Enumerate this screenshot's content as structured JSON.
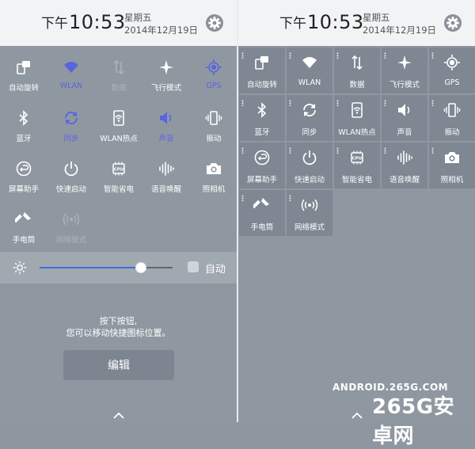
{
  "left_panel": {
    "header": {
      "ampm": "下午",
      "time": "10:53",
      "day": "星期五",
      "date": "2014年12月19日"
    },
    "toggles": [
      {
        "label": "自动旋转",
        "icon": "auto-rotate-icon",
        "state": "on"
      },
      {
        "label": "WLAN",
        "icon": "wifi-icon",
        "state": "active"
      },
      {
        "label": "数据",
        "icon": "mobile-data-icon",
        "state": "disabled"
      },
      {
        "label": "飞行模式",
        "icon": "airplane-icon",
        "state": "on"
      },
      {
        "label": "GPS",
        "icon": "gps-icon",
        "state": "active"
      },
      {
        "label": "蓝牙",
        "icon": "bluetooth-icon",
        "state": "on"
      },
      {
        "label": "同步",
        "icon": "sync-icon",
        "state": "active"
      },
      {
        "label": "WLAN热点",
        "icon": "hotspot-icon",
        "state": "on"
      },
      {
        "label": "声音",
        "icon": "sound-icon",
        "state": "active"
      },
      {
        "label": "振动",
        "icon": "vibrate-icon",
        "state": "on"
      },
      {
        "label": "屏幕助手",
        "icon": "screen-assistant-icon",
        "state": "on"
      },
      {
        "label": "快速启动",
        "icon": "power-icon",
        "state": "on"
      },
      {
        "label": "智能省电",
        "icon": "cpu-icon",
        "state": "on"
      },
      {
        "label": "语音唤醒",
        "icon": "voice-wake-icon",
        "state": "on"
      },
      {
        "label": "照相机",
        "icon": "camera-icon",
        "state": "on"
      },
      {
        "label": "手电筒",
        "icon": "flashlight-icon",
        "state": "on"
      },
      {
        "label": "网络模式",
        "icon": "network-mode-icon",
        "state": "disabled"
      }
    ],
    "brightness": {
      "level": 0.76,
      "auto_label": "自动",
      "auto_checked": false
    },
    "hint": {
      "line1": "按下按钮,",
      "line2": "您可以移动快捷图标位置。"
    },
    "edit_label": "编辑"
  },
  "right_panel": {
    "header": {
      "ampm": "下午",
      "time": "10:53",
      "day": "星期五",
      "date": "2014年12月19日"
    },
    "tiles": [
      {
        "label": "自动旋转",
        "icon": "auto-rotate-icon"
      },
      {
        "label": "WLAN",
        "icon": "wifi-icon"
      },
      {
        "label": "数据",
        "icon": "mobile-data-icon"
      },
      {
        "label": "飞行模式",
        "icon": "airplane-icon"
      },
      {
        "label": "GPS",
        "icon": "gps-icon"
      },
      {
        "label": "蓝牙",
        "icon": "bluetooth-icon"
      },
      {
        "label": "同步",
        "icon": "sync-icon"
      },
      {
        "label": "WLAN热点",
        "icon": "hotspot-icon"
      },
      {
        "label": "声音",
        "icon": "sound-icon"
      },
      {
        "label": "振动",
        "icon": "vibrate-icon"
      },
      {
        "label": "屏幕助手",
        "icon": "screen-assistant-icon"
      },
      {
        "label": "快速启动",
        "icon": "power-icon"
      },
      {
        "label": "智能省电",
        "icon": "cpu-icon"
      },
      {
        "label": "语音唤醒",
        "icon": "voice-wake-icon"
      },
      {
        "label": "照相机",
        "icon": "camera-icon"
      },
      {
        "label": "手电筒",
        "icon": "flashlight-icon"
      },
      {
        "label": "网络模式",
        "icon": "network-mode-icon"
      }
    ]
  },
  "watermark": {
    "site": "ANDROID.265G.COM",
    "brand": "265G安卓网"
  },
  "colors": {
    "active": "#5a64e0",
    "slider": "#3f6ee2",
    "background": "#8f98a1",
    "header": "#f2f3f5"
  }
}
